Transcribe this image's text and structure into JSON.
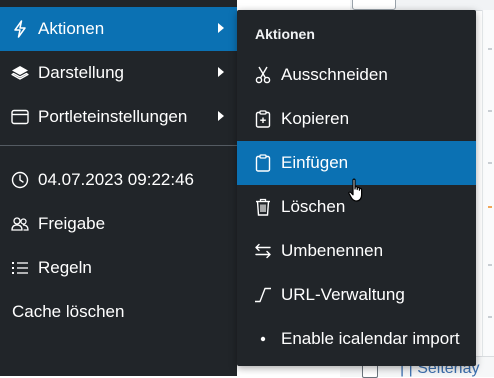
{
  "main_menu": {
    "items": [
      {
        "label": "Aktionen",
        "icon": "lightning-icon",
        "has_submenu": true,
        "active": true
      },
      {
        "label": "Darstellung",
        "icon": "layers-icon",
        "has_submenu": true
      },
      {
        "label": "Portleteinstellungen",
        "icon": "window-icon",
        "has_submenu": true
      }
    ],
    "info_items": [
      {
        "label": "04.07.2023 09:22:46",
        "icon": "clock-icon"
      },
      {
        "label": "Freigabe",
        "icon": "users-icon"
      },
      {
        "label": "Regeln",
        "icon": "list-icon"
      },
      {
        "label": "Cache löschen"
      }
    ]
  },
  "submenu": {
    "title": "Aktionen",
    "items": [
      {
        "label": "Ausschneiden",
        "icon": "scissors-icon"
      },
      {
        "label": "Kopieren",
        "icon": "clipboard-plus-icon"
      },
      {
        "label": "Einfügen",
        "icon": "clipboard-icon",
        "hovered": true
      },
      {
        "label": "Löschen",
        "icon": "trash-icon"
      },
      {
        "label": "Umbenennen",
        "icon": "swap-arrows-icon"
      },
      {
        "label": "URL-Verwaltung",
        "icon": "url-path-icon"
      },
      {
        "label": "Enable icalendar import",
        "icon": "bullet-icon"
      }
    ]
  },
  "background": {
    "bottom_text": "| | Seitenay"
  },
  "colors": {
    "menu_bg": "#212529",
    "active_bg": "#0b71b3",
    "text": "#ffffff"
  }
}
